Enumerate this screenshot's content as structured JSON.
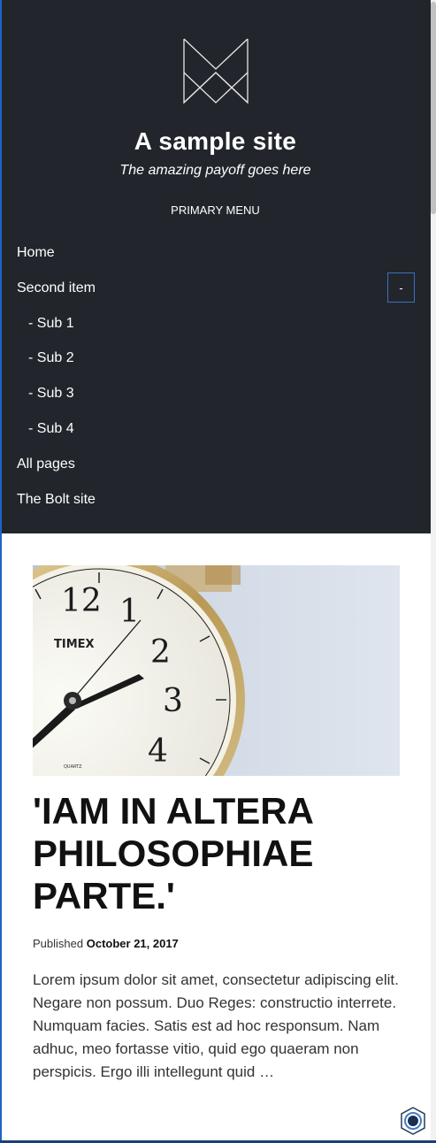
{
  "site": {
    "title": "A sample site",
    "tagline": "The amazing payoff goes here"
  },
  "menu": {
    "title": "PRIMARY MENU",
    "items": [
      {
        "label": "Home"
      },
      {
        "label": "Second item"
      },
      {
        "label": "- Sub 1"
      },
      {
        "label": "- Sub 2"
      },
      {
        "label": "- Sub 3"
      },
      {
        "label": "- Sub 4"
      },
      {
        "label": "All pages"
      },
      {
        "label": "The Bolt site"
      }
    ],
    "toggle_label": "-"
  },
  "post": {
    "image_brand": "TIMEX",
    "image_subtext": "QUARTZ",
    "title": "'IAM IN ALTERA PHILOSOPHIAE PARTE.'",
    "published_label": "Published",
    "published_date": "October 21, 2017",
    "excerpt": "Lorem ipsum dolor sit amet, consectetur adipiscing elit. Negare non possum. Duo Reges: constructio interrete. Numquam facies. Satis est ad hoc responsum. Nam adhuc, meo fortasse vitio, quid ego quaeram non perspicis. Ergo illi intellegunt quid …"
  },
  "icons": {
    "logo": "bolt-logo-icon",
    "fab": "settings-fab-icon"
  }
}
